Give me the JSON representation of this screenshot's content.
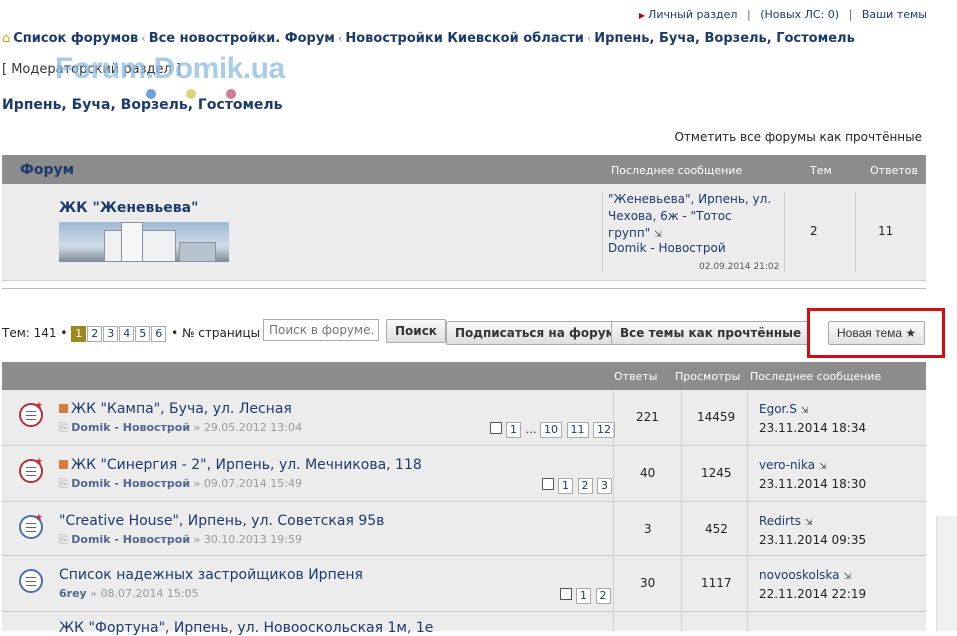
{
  "topbar": {
    "personal": "Личный раздел",
    "pm": "(Новых ЛС: 0)",
    "your_topics": "Ваши темы"
  },
  "breadcrumb": [
    "Список форумов",
    "Все новостройки. Форум",
    "Новостройки Киевской области",
    "Ирпень, Буча, Ворзель, Гостомель"
  ],
  "moderator_section": "[ Модераторский раздел ]",
  "logo": "Forum.Domik.ua",
  "forum_title": "Ирпень, Буча, Ворзель, Гостомель",
  "mark_read": "Отметить все форумы как прочтённые",
  "subforum_header": {
    "forum": "Форум",
    "last": "Последнее сообщение",
    "topics": "Тем",
    "replies": "Ответов"
  },
  "subforum": {
    "name": "ЖК \"Женевьева\"",
    "last_title": "\"Женевьева\", Ирпень, ул. Чехова, 6ж - \"Тотос групп\"",
    "last_by": "Domik - Новострой",
    "last_date": "02.09.2014 21:02",
    "topics": "2",
    "replies": "11"
  },
  "pagination": {
    "label": "Тем: 141 •",
    "pages": [
      "1",
      "2",
      "3",
      "4",
      "5",
      "6"
    ],
    "suffix": "• № страницы ^"
  },
  "search": {
    "placeholder": "Поиск в форуме…",
    "button": "Поиск"
  },
  "buttons": {
    "subscribe": "Подписаться на форум",
    "mark_all": "Все темы как прочтённые",
    "new_topic": "Новая тема ★"
  },
  "topic_header": {
    "replies": "Ответы",
    "views": "Просмотры",
    "last": "Последнее сообщение"
  },
  "topics": [
    {
      "title": "ЖК \"Кампа\", Буча, ул. Лесная",
      "author": "Domik - Новострой",
      "date": "29.05.2012 13:04",
      "pages": [
        "1",
        "…",
        "10",
        "11",
        "12"
      ],
      "replies": "221",
      "views": "14459",
      "last_by": "Egor.S",
      "last_date": "23.11.2014 18:34"
    },
    {
      "title": "ЖК \"Синергия - 2\", Ирпень, ул. Мечникова, 118",
      "author": "Domik - Новострой",
      "date": "09.07.2014 15:49",
      "pages": [
        "1",
        "2",
        "3"
      ],
      "replies": "40",
      "views": "1245",
      "last_by": "vero-nika",
      "last_date": "23.11.2014 18:30"
    },
    {
      "title": "\"Creative House\", Ирпень, ул. Советская 95в",
      "author": "Domik - Новострой",
      "date": "30.10.2013 19:59",
      "pages": [],
      "replies": "3",
      "views": "452",
      "last_by": "Redirts",
      "last_date": "23.11.2014 09:35"
    },
    {
      "title": "Список надежных застройщиков Ирпеня",
      "author": "6rey",
      "date": "08.07.2014 15:05",
      "pages": [
        "1",
        "2"
      ],
      "replies": "30",
      "views": "1117",
      "last_by": "novooskolska",
      "last_date": "22.11.2014 22:19"
    },
    {
      "title": "ЖК \"Фортуна\", Ирпень, ул. Новооскольская 1м, 1е"
    }
  ]
}
